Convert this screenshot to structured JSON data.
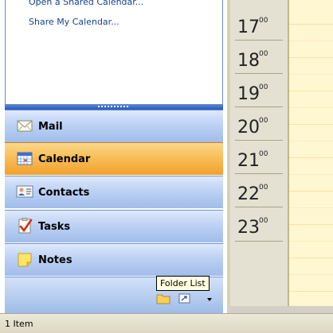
{
  "navigation_pane": {
    "links": [
      "Open a Shared Calendar...",
      "Share My Calendar..."
    ],
    "buttons": [
      {
        "label": "Mail",
        "icon": "envelope-icon"
      },
      {
        "label": "Calendar",
        "icon": "calendar-icon",
        "selected": true
      },
      {
        "label": "Contacts",
        "icon": "contact-card-icon"
      },
      {
        "label": "Tasks",
        "icon": "checkmark-clipboard-icon"
      },
      {
        "label": "Notes",
        "icon": "sticky-note-icon"
      }
    ],
    "bottom_icons": [
      "folder-list-icon",
      "shortcuts-icon",
      "configure-buttons-icon"
    ],
    "tooltip": "Folder List"
  },
  "calendar": {
    "hours": [
      {
        "hour": "17",
        "minutes": "00"
      },
      {
        "hour": "18",
        "minutes": "00"
      },
      {
        "hour": "19",
        "minutes": "00"
      },
      {
        "hour": "20",
        "minutes": "00"
      },
      {
        "hour": "21",
        "minutes": "00"
      },
      {
        "hour": "22",
        "minutes": "00"
      },
      {
        "hour": "23",
        "minutes": "00"
      }
    ]
  },
  "status_bar": {
    "text": "1 Item"
  },
  "colors": {
    "selected_button": "#f8bb54",
    "button": "#bcd1f4",
    "grid": "#fff7d2",
    "time_column": "#e4e1d2"
  }
}
